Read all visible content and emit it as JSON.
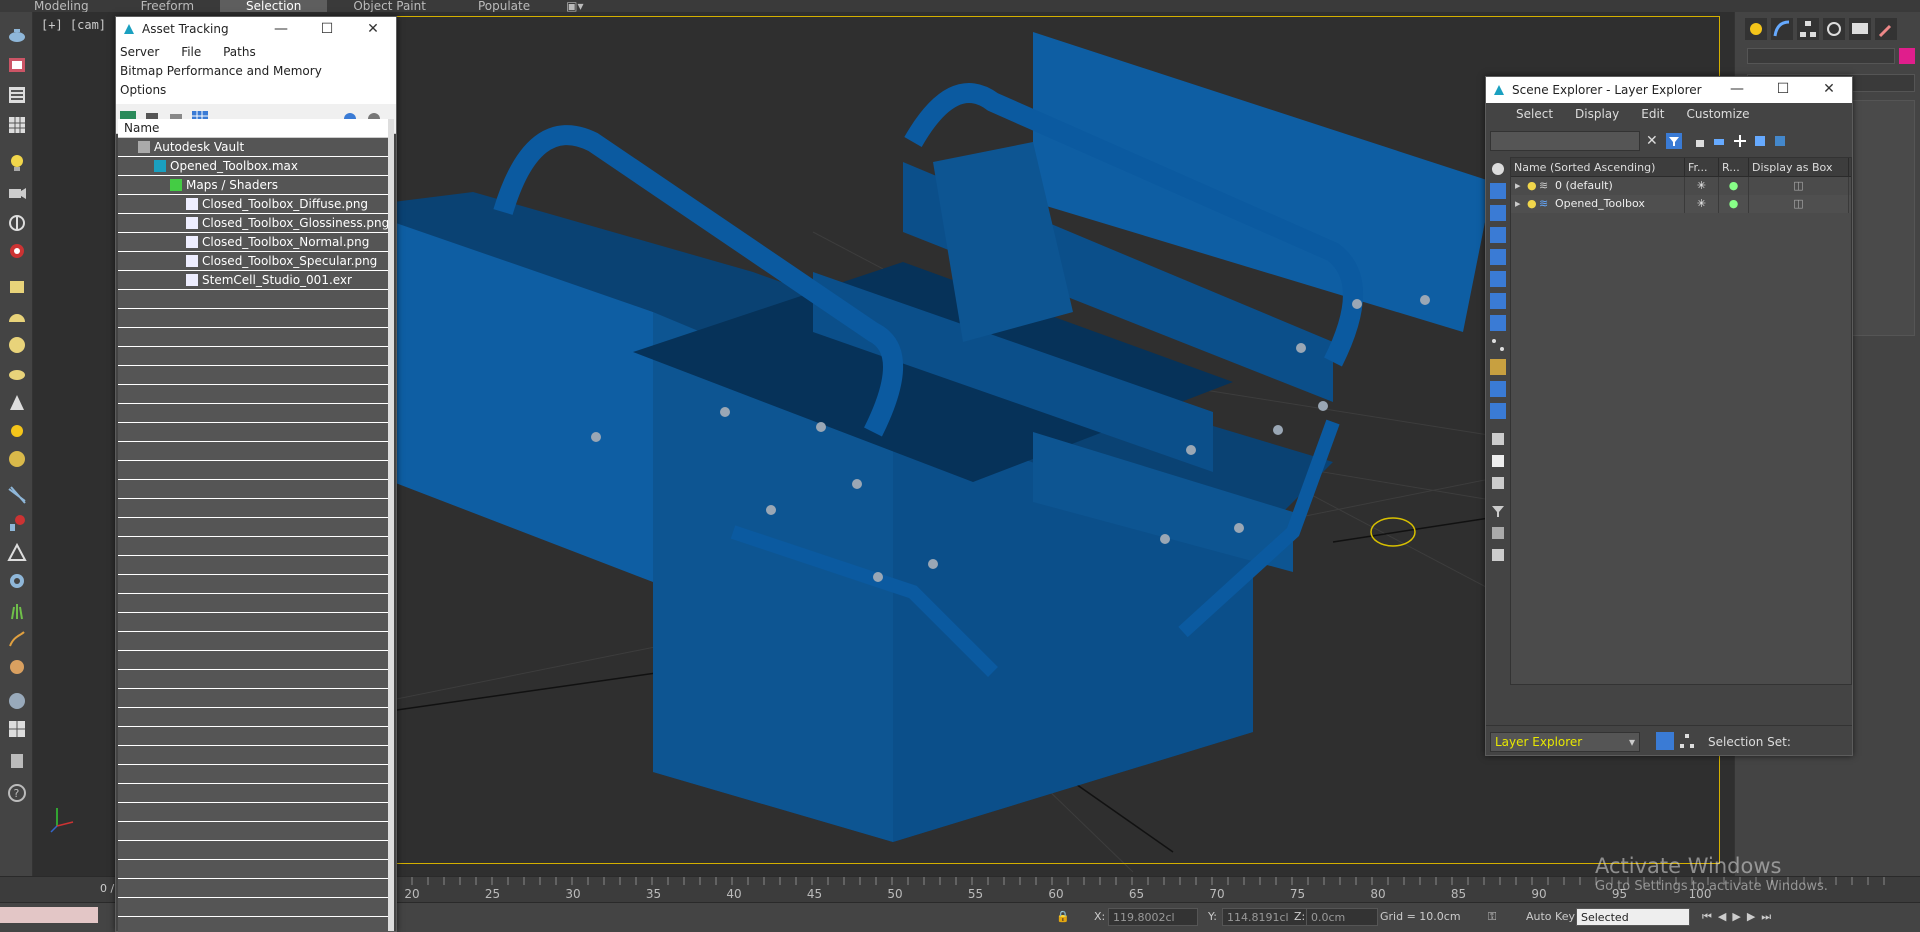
{
  "ribbon": {
    "tabs": [
      "Modeling",
      "Freeform",
      "Selection",
      "Object Paint",
      "Populate"
    ],
    "active": "Selection"
  },
  "viewport": {
    "label": "[+] [cam] [S",
    "frame_color": "#d4b000",
    "object_color": "#0b4f8a"
  },
  "asset_tracking": {
    "title": "Asset Tracking",
    "menu": [
      "Server",
      "File",
      "Paths"
    ],
    "menu2": [
      "Bitmap Performance and Memory",
      "Options"
    ],
    "column_header": "Name",
    "rows": [
      {
        "label": "Autodesk Vault",
        "level": 0,
        "icon": "vault-icon"
      },
      {
        "label": "Opened_Toolbox.max",
        "level": 1,
        "icon": "max-file-icon"
      },
      {
        "label": "Maps / Shaders",
        "level": 2,
        "icon": "maps-folder-icon"
      },
      {
        "label": "Closed_Toolbox_Diffuse.png",
        "level": 3,
        "icon": "image-file-icon"
      },
      {
        "label": "Closed_Toolbox_Glossiness.png",
        "level": 3,
        "icon": "image-file-icon"
      },
      {
        "label": "Closed_Toolbox_Normal.png",
        "level": 3,
        "icon": "image-file-icon"
      },
      {
        "label": "Closed_Toolbox_Specular.png",
        "level": 3,
        "icon": "image-file-icon"
      },
      {
        "label": "StemCell_Studio_001.exr",
        "level": 3,
        "icon": "image-file-icon"
      }
    ]
  },
  "scene_explorer": {
    "title": "Scene Explorer - Layer Explorer",
    "menu": [
      "Select",
      "Display",
      "Edit",
      "Customize"
    ],
    "columns": [
      "Name (Sorted Ascending)",
      "Fr...",
      "R...",
      "Display as Box"
    ],
    "rows": [
      {
        "name": "0 (default)"
      },
      {
        "name": "Opened_Toolbox"
      }
    ],
    "footer_dropdown": "Layer Explorer",
    "selection_set_label": "Selection Set:"
  },
  "timeline": {
    "ticks": [
      "20",
      "25",
      "30",
      "35",
      "40",
      "45",
      "50",
      "55",
      "60",
      "65",
      "70",
      "75",
      "80",
      "85",
      "90",
      "95",
      "100"
    ],
    "frame_counter": "0 / "
  },
  "status": {
    "x_label": "X:",
    "x_value": "119.8002cl",
    "y_label": "Y:",
    "y_value": "114.8191cl",
    "z_label": "Z:",
    "z_value": "0.0cm",
    "grid": "Grid = 10.0cm",
    "auto_key": "Auto Key",
    "selected": "Selected"
  },
  "watermark": {
    "title": "Activate Windows",
    "subtitle": "Go to Settings to activate Windows."
  }
}
